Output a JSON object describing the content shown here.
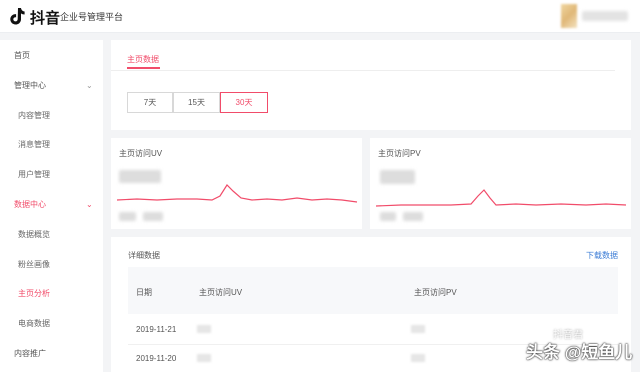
{
  "header": {
    "brand": "抖音",
    "subtitle": "企业号管理平台"
  },
  "sidebar": {
    "items": [
      {
        "label": "首页"
      },
      {
        "label": "管理中心"
      },
      {
        "label": "内容管理"
      },
      {
        "label": "消息管理"
      },
      {
        "label": "用户管理"
      },
      {
        "label": "数据中心"
      },
      {
        "label": "数据概览"
      },
      {
        "label": "粉丝画像"
      },
      {
        "label": "主页分析"
      },
      {
        "label": "电商数据"
      },
      {
        "label": "内容推广"
      }
    ]
  },
  "main": {
    "tab": "主页数据",
    "ranges": [
      "7天",
      "15天",
      "30天"
    ],
    "selected_range": "30天",
    "uv_card": {
      "title": "主页访问UV"
    },
    "pv_card": {
      "title": "主页访问PV"
    },
    "detail": {
      "title": "详细数据",
      "download": "下载数据",
      "columns": [
        "日期",
        "主页访问UV",
        "主页访问PV"
      ],
      "rows": [
        {
          "date": "2019-11-21"
        },
        {
          "date": "2019-11-20"
        }
      ]
    }
  },
  "watermark": {
    "text": "头条 @短鱼儿",
    "faint": "抖音君"
  },
  "colors": {
    "accent": "#f14c6a",
    "link": "#3a7bd5"
  },
  "icons": {
    "logo": "douyin-note-icon",
    "chevron_down": "chevron-down-icon",
    "chevron_up": "chevron-up-icon"
  }
}
